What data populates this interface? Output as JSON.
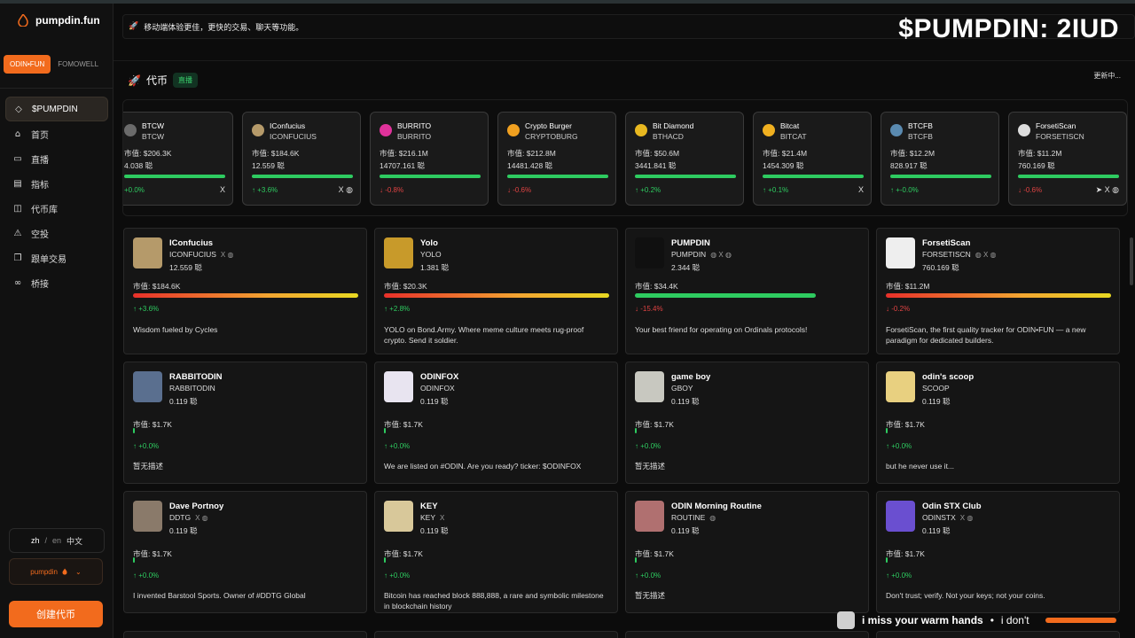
{
  "brand": {
    "name": "pumpdin.fun"
  },
  "overlay_title": "$PUMPDIN: 2IUD",
  "platform_tabs": {
    "active": "ODIN•FUN",
    "inactive": "FOMOWELL"
  },
  "nav": [
    {
      "label": "$PUMPDIN",
      "icon": "◇"
    },
    {
      "label": "首页",
      "icon": "⌂"
    },
    {
      "label": "直播",
      "icon": "▭"
    },
    {
      "label": "指标",
      "icon": "▤"
    },
    {
      "label": "代币库",
      "icon": "◫"
    },
    {
      "label": "空投",
      "icon": "⚠"
    },
    {
      "label": "跟单交易",
      "icon": "❐"
    },
    {
      "label": "桥接",
      "icon": "∞"
    }
  ],
  "language": {
    "zh": "zh",
    "sep": "/",
    "en": "en",
    "cn": "中文"
  },
  "user": {
    "name": "pumpdin",
    "chevron": "⌄"
  },
  "create_button": "创建代币",
  "banner": {
    "text": "移动端体验更佳，更快的交易、聊天等功能。",
    "icon": "rocket-icon"
  },
  "section": {
    "title": "代币",
    "live_badge": "直播",
    "updating": "更新中..."
  },
  "ticker": [
    {
      "name": "BTCW",
      "symbol": "BTCW",
      "mcap": "市值: $206.3K",
      "holders": "4.038 聪",
      "change": "+0.0%",
      "dir": "up",
      "bar": 1.0,
      "socials": "X",
      "color": "#6b6b6b"
    },
    {
      "name": "IConfucius",
      "symbol": "ICONFUCIUS",
      "mcap": "市值: $184.6K",
      "holders": "12.559 聪",
      "change": "↑ +3.6%",
      "dir": "up",
      "bar": 1.0,
      "socials": "X ◍",
      "color": "#b59a6a"
    },
    {
      "name": "BURRITO",
      "symbol": "BURRITO",
      "mcap": "市值: $216.1M",
      "holders": "14707.161 聪",
      "change": "↓ -0.8%",
      "dir": "down",
      "bar": 1.0,
      "socials": "",
      "color": "#e0329b"
    },
    {
      "name": "Crypto Burger",
      "symbol": "CRYPTOBURG",
      "mcap": "市值: $212.8M",
      "holders": "14481.428 聪",
      "change": "↓ -0.6%",
      "dir": "down",
      "bar": 1.0,
      "socials": "",
      "color": "#f0a020"
    },
    {
      "name": "Bit Diamond",
      "symbol": "BTHACD",
      "mcap": "市值: $50.6M",
      "holders": "3441.841 聪",
      "change": "↑ +0.2%",
      "dir": "up",
      "bar": 1.0,
      "socials": "",
      "color": "#e8b820"
    },
    {
      "name": "Bitcat",
      "symbol": "BITCAT",
      "mcap": "市值: $21.4M",
      "holders": "1454.309 聪",
      "change": "↑ +0.1%",
      "dir": "up",
      "bar": 1.0,
      "socials": "X",
      "color": "#f0b020"
    },
    {
      "name": "BTCFB",
      "symbol": "BTCFB",
      "mcap": "市值: $12.2M",
      "holders": "828.917 聪",
      "change": "↑ +-0.0%",
      "dir": "up",
      "bar": 1.0,
      "socials": "",
      "color": "#5a8ab0"
    },
    {
      "name": "ForsetiScan",
      "symbol": "FORSETISCN",
      "mcap": "市值: $11.2M",
      "holders": "760.169 聪",
      "change": "↓ -0.6%",
      "dir": "down",
      "bar": 1.0,
      "socials": "➤ X ◍",
      "color": "#dddddd"
    }
  ],
  "cards": [
    {
      "name": "IConfucius",
      "symbol": "ICONFUCIUS",
      "socials": "X ◍",
      "holders": "12.559 聪",
      "mcap": "市值: $184.6K",
      "change": "↑ +3.6%",
      "dir": "up",
      "bar": "grad",
      "desc": "Wisdom fueled by Cycles",
      "color": "#b59a6a"
    },
    {
      "name": "Yolo",
      "symbol": "YOLO",
      "socials": "",
      "holders": "1.381 聪",
      "mcap": "市值: $20.3K",
      "change": "↑ +2.8%",
      "dir": "up",
      "bar": "grad",
      "desc": "YOLO on Bond.Army. Where meme culture meets rug-proof crypto. Send it soldier.",
      "color": "#c89a2a"
    },
    {
      "name": "PUMPDIN",
      "symbol": "PUMPDIN",
      "socials": "◍ X ◍",
      "holders": "2.344 聪",
      "mcap": "市值: $34.4K",
      "change": "↓ -15.4%",
      "dir": "down",
      "bar": "green",
      "desc": "Your best friend for operating on Ordinals protocols!",
      "color": "#101010"
    },
    {
      "name": "ForsetiScan",
      "symbol": "FORSETISCN",
      "socials": "◍ X ◍",
      "holders": "760.169 聪",
      "mcap": "市值: $11.2M",
      "change": "↓ -0.2%",
      "dir": "down",
      "bar": "grad",
      "desc": "ForsetiScan, the first quality tracker for ODIN•FUN — a new paradigm for dedicated builders.",
      "color": "#eeeeee"
    },
    {
      "name": "RABBITODIN",
      "symbol": "RABBITODIN",
      "socials": "",
      "holders": "0.119 聪",
      "mcap": "市值: $1.7K",
      "change": "↑ +0.0%",
      "dir": "up",
      "bar": "tick",
      "desc": "暂无描述",
      "color": "#5a6f8f"
    },
    {
      "name": "ODINFOX",
      "symbol": "ODINFOX",
      "socials": "",
      "holders": "0.119 聪",
      "mcap": "市值: $1.7K",
      "change": "↑ +0.0%",
      "dir": "up",
      "bar": "tick",
      "desc": "We are listed on #ODIN. Are you ready? ticker: $ODINFOX",
      "color": "#e8e4f0"
    },
    {
      "name": "game boy",
      "symbol": "GBOY",
      "socials": "",
      "holders": "0.119 聪",
      "mcap": "市值: $1.7K",
      "change": "↑ +0.0%",
      "dir": "up",
      "bar": "tick",
      "desc": "暂无描述",
      "color": "#c8c8c0"
    },
    {
      "name": "odin's scoop",
      "symbol": "SCOOP",
      "socials": "",
      "holders": "0.119 聪",
      "mcap": "市值: $1.7K",
      "change": "↑ +0.0%",
      "dir": "up",
      "bar": "tick",
      "desc": "but he never use it...",
      "color": "#e8d080"
    },
    {
      "name": "Dave Portnoy",
      "symbol": "DDTG",
      "socials": "X ◍",
      "holders": "0.119 聪",
      "mcap": "市值: $1.7K",
      "change": "↑ +0.0%",
      "dir": "up",
      "bar": "tick",
      "desc": "I invented Barstool Sports. Owner of #DDTG Global",
      "color": "#8a7a6a"
    },
    {
      "name": "KEY",
      "symbol": "KEY",
      "socials": "X",
      "holders": "0.119 聪",
      "mcap": "市值: $1.7K",
      "change": "↑ +0.0%",
      "dir": "up",
      "bar": "tick",
      "desc": "Bitcoin has reached block 888,888, a rare and symbolic milestone in blockchain history",
      "color": "#d8c89a"
    },
    {
      "name": "ODIN Morning Routine",
      "symbol": "ROUTINE",
      "socials": "◍",
      "holders": "0.119 聪",
      "mcap": "市值: $1.7K",
      "change": "↑ +0.0%",
      "dir": "up",
      "bar": "tick",
      "desc": "暂无描述",
      "color": "#b07070"
    },
    {
      "name": "Odin STX Club",
      "symbol": "ODINSTX",
      "socials": "X ◍",
      "holders": "0.119 聪",
      "mcap": "市值: $1.7K",
      "change": "↑ +0.0%",
      "dir": "up",
      "bar": "tick",
      "desc": "Don't trust; verify. Not your keys; not your coins.",
      "color": "#6a4fd0"
    }
  ],
  "music": {
    "title": "i miss your warm hands",
    "dot": "•",
    "next": "i don't"
  }
}
